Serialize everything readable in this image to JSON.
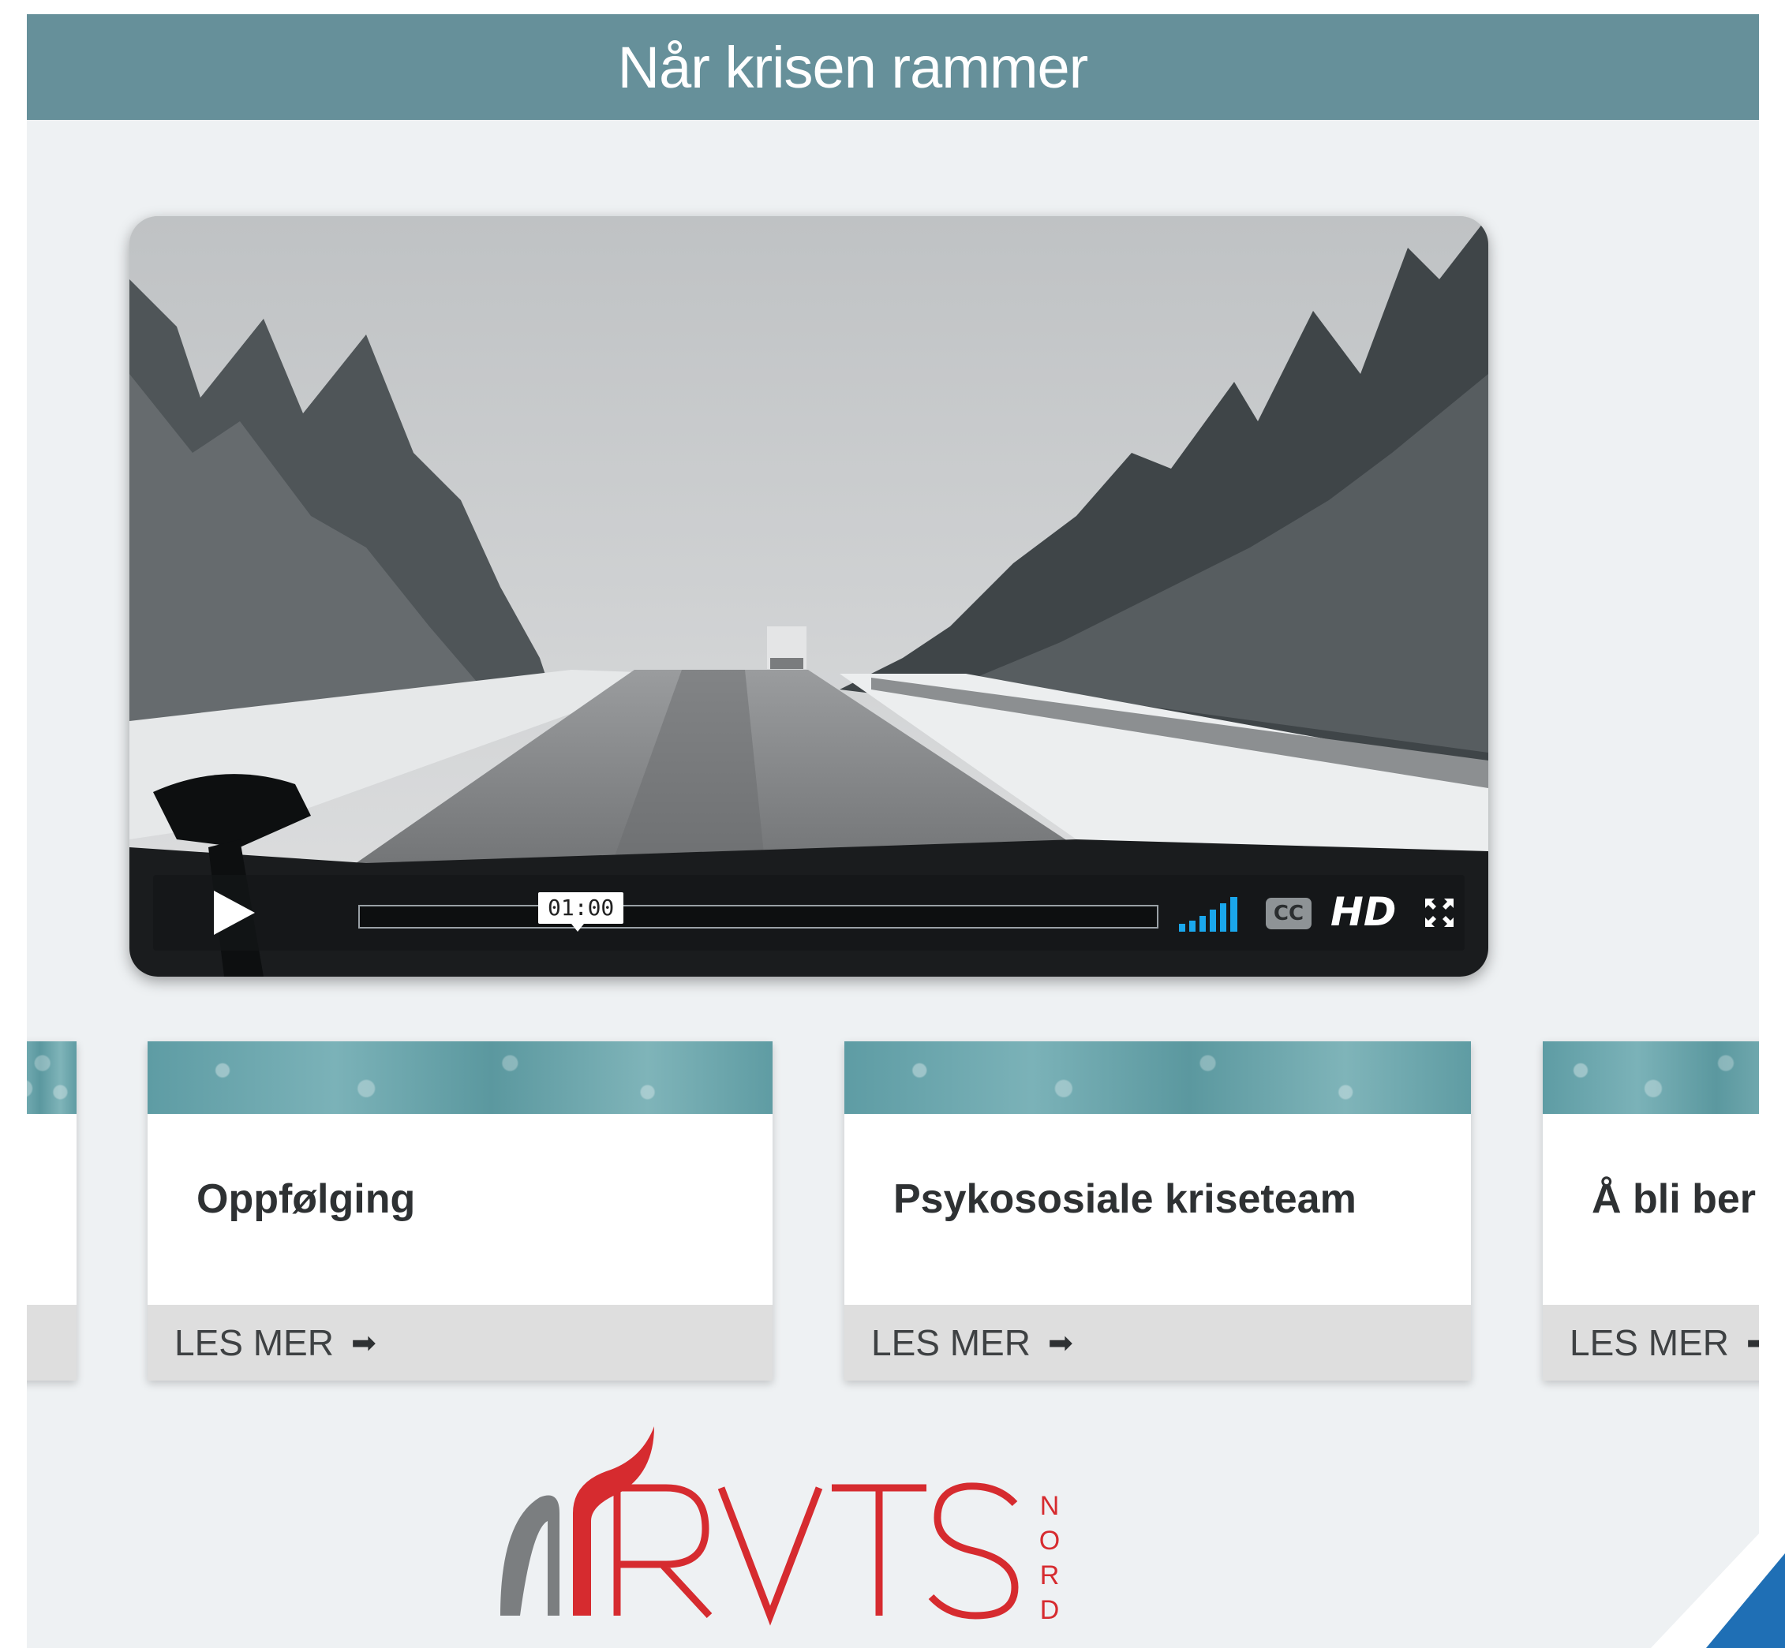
{
  "header": {
    "title": "Når krisen rammer"
  },
  "video": {
    "time": "01:00",
    "cc_label": "CC",
    "hd_label": "HD"
  },
  "cards": [
    {
      "title": "",
      "link": ""
    },
    {
      "title": "Oppfølging",
      "link": "LES MER"
    },
    {
      "title": "Psykososiale kriseteam",
      "link": "LES MER"
    },
    {
      "title": "Å bli ber",
      "link": "LES MER"
    }
  ],
  "logo": {
    "text": "RVTS",
    "sub": "NORD"
  },
  "colors": {
    "header": "#66909a",
    "logo_red": "#d62b2f",
    "accent_blue": "#1f6fb5"
  }
}
